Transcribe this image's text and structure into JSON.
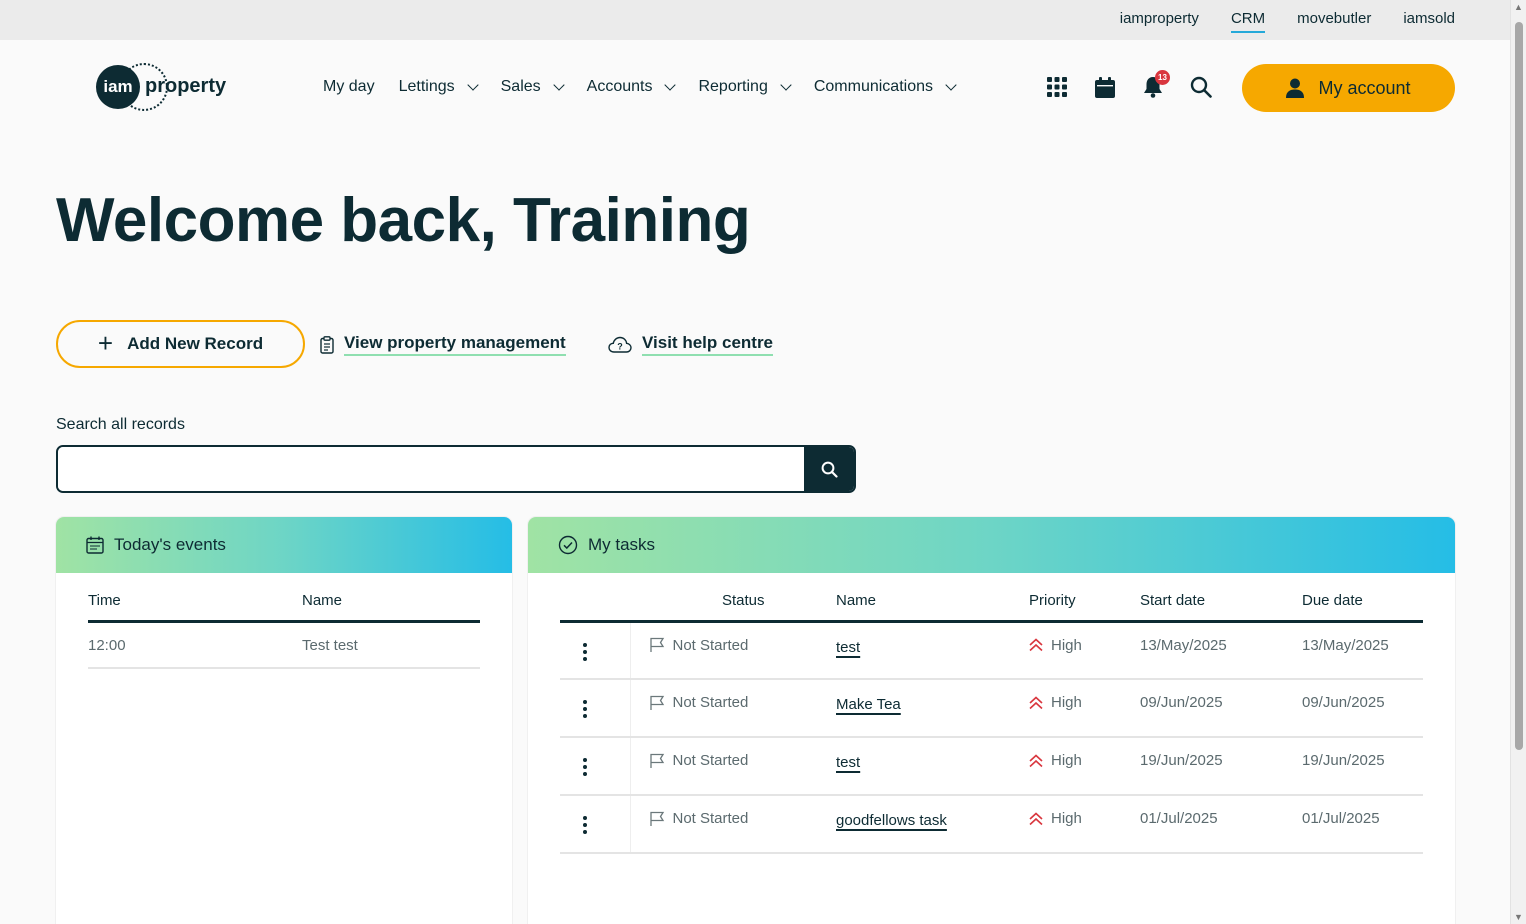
{
  "topbar": {
    "links": [
      {
        "label": "iamproperty",
        "active": false
      },
      {
        "label": "CRM",
        "active": true
      },
      {
        "label": "movebutler",
        "active": false
      },
      {
        "label": "iamsold",
        "active": false
      }
    ]
  },
  "logo": {
    "mark": "iam",
    "word": "property"
  },
  "nav": {
    "my_day": "My day",
    "lettings": "Lettings",
    "sales": "Sales",
    "accounts": "Accounts",
    "reporting": "Reporting",
    "communications": "Communications"
  },
  "header_icons": {
    "apps": "grid-apps-icon",
    "calendar": "calendar-icon",
    "notifications": "bell-icon",
    "notification_count": "13",
    "search": "search-icon"
  },
  "account": {
    "label": "My account"
  },
  "welcome": {
    "title": "Welcome back, Training"
  },
  "actions": {
    "add_record": "Add New Record",
    "view_property_management": "View property management",
    "visit_help_centre": "Visit help centre"
  },
  "search": {
    "label": "Search all records",
    "value": "",
    "placeholder": ""
  },
  "events": {
    "title": "Today's events",
    "columns": {
      "time": "Time",
      "name": "Name"
    },
    "rows": [
      {
        "time": "12:00",
        "name": "Test test"
      }
    ]
  },
  "tasks": {
    "title": "My tasks",
    "columns": {
      "status": "Status",
      "name": "Name",
      "priority": "Priority",
      "start": "Start date",
      "due": "Due date"
    },
    "rows": [
      {
        "status": "Not Started",
        "name": "test",
        "priority": "High",
        "start": "13/May/2025",
        "due": "13/May/2025"
      },
      {
        "status": "Not Started",
        "name": "Make Tea",
        "priority": "High",
        "start": "09/Jun/2025",
        "due": "09/Jun/2025"
      },
      {
        "status": "Not Started",
        "name": "test",
        "priority": "High",
        "start": "19/Jun/2025",
        "due": "19/Jun/2025"
      },
      {
        "status": "Not Started",
        "name": "goodfellows task",
        "priority": "High",
        "start": "01/Jul/2025",
        "due": "01/Jul/2025"
      }
    ]
  },
  "colors": {
    "brand_dark": "#0d2b33",
    "accent_orange": "#f6a800",
    "link_underline": "#8fdfb0",
    "priority_high": "#d9363e"
  }
}
